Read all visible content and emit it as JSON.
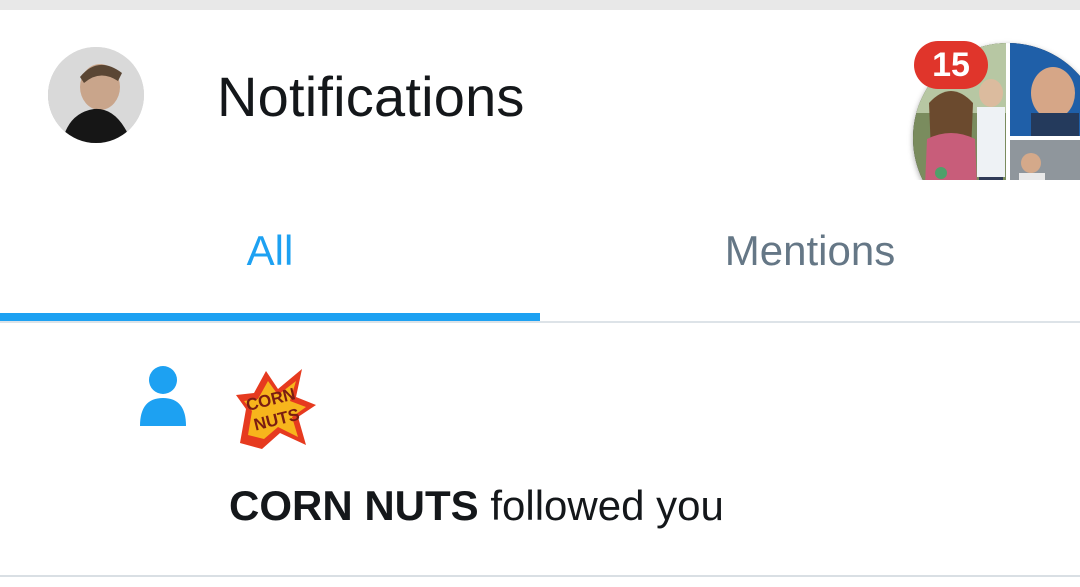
{
  "header": {
    "title": "Notifications",
    "avatar_icon": "user-avatar",
    "chat_bubble": {
      "badge_count": "15",
      "badge_color": "#e0352b"
    }
  },
  "tabs": [
    {
      "label": "All",
      "selected": true
    },
    {
      "label": "Mentions",
      "selected": false
    }
  ],
  "colors": {
    "accent": "#1da1f2",
    "inactive_tab": "#657786",
    "text": "#14171a"
  },
  "notifications": [
    {
      "type_icon": "person-follow-icon",
      "logo_text_top": "CORN",
      "logo_text_bottom": "NUTS",
      "actor": "CORN NUTS",
      "action": " followed you"
    }
  ]
}
